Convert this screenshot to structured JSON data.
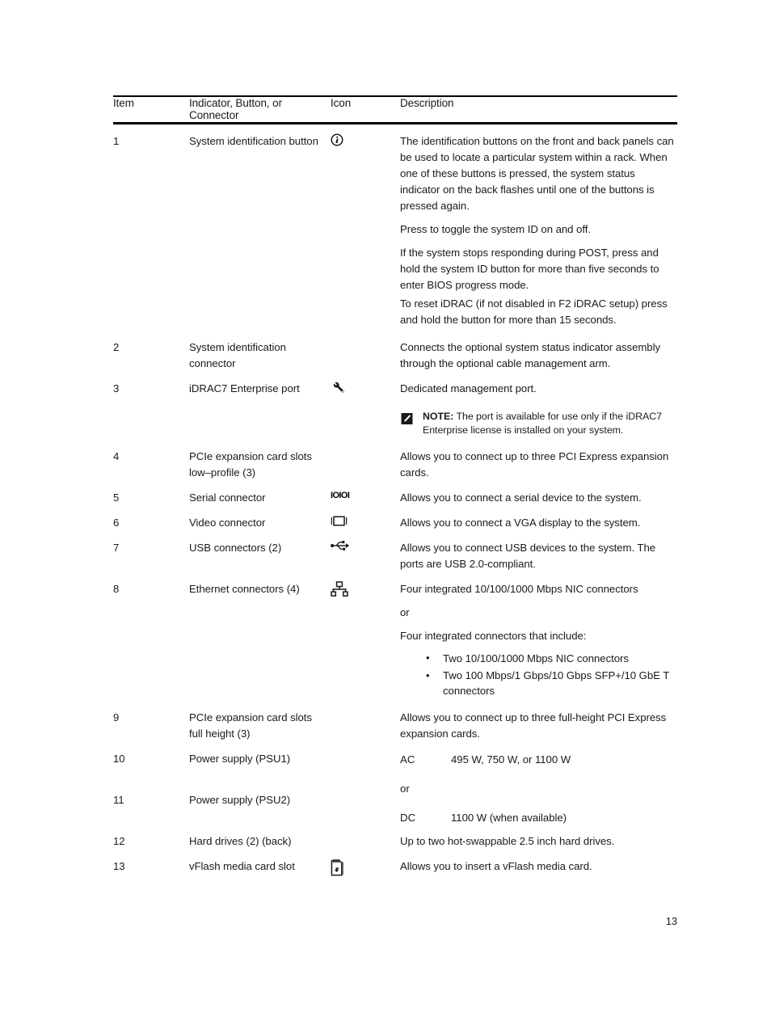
{
  "page": {
    "number": "13"
  },
  "table": {
    "headers": {
      "item": "Item",
      "connector_line1": "Indicator, Button, or",
      "connector_line2": "Connector",
      "icon": "Icon",
      "description": "Description"
    },
    "rows": [
      {
        "item": "1",
        "name_line1": "System identification button",
        "name_line2": "",
        "icon": "info-circle-icon",
        "desc_paragraphs": [
          "The identification buttons on the front and back panels can be used to locate a particular system within a rack. When one of these buttons is pressed, the system status indicator on the back flashes until one of the buttons is pressed again.",
          "Press to toggle the system ID on and off.",
          "If the system stops responding during POST, press and hold the system ID button for more than five seconds to enter BIOS progress mode.",
          "To reset iDRAC (if not disabled in F2 iDRAC setup) press and hold the button for more than 15 seconds."
        ]
      },
      {
        "item": "2",
        "name_line1": "System identification",
        "name_line2": "connector",
        "icon": "",
        "desc_paragraphs": [
          "Connects the optional system status indicator assembly through the optional cable management arm."
        ]
      },
      {
        "item": "3",
        "name_line1": "iDRAC7 Enterprise port",
        "name_line2": "",
        "icon": "wrench-icon",
        "desc_paragraphs": [
          "Dedicated management port."
        ],
        "note": {
          "label": "NOTE:",
          "text": " The port is available for use only if the iDRAC7 Enterprise license is installed on your system."
        }
      },
      {
        "item": "4",
        "name_line1": "PCIe expansion card slots",
        "name_line2": "low–profile (3)",
        "icon": "",
        "desc_paragraphs": [
          "Allows you to connect up to three PCI Express expansion cards."
        ]
      },
      {
        "item": "5",
        "name_line1": "Serial connector",
        "name_line2": "",
        "icon": "serial-connector-icon",
        "icon_text": "IOIOI",
        "desc_paragraphs": [
          "Allows you to connect a serial device to the system."
        ]
      },
      {
        "item": "6",
        "name_line1": "Video connector",
        "name_line2": "",
        "icon": "video-connector-icon",
        "desc_paragraphs": [
          "Allows you to connect a VGA display to the system."
        ]
      },
      {
        "item": "7",
        "name_line1": "USB connectors (2)",
        "name_line2": "",
        "icon": "usb-icon",
        "desc_paragraphs": [
          "Allows you to connect USB devices to the system. The ports are USB 2.0-compliant."
        ]
      },
      {
        "item": "8",
        "name_line1": "Ethernet connectors (4)",
        "name_line2": "",
        "icon": "ethernet-icon",
        "desc_paragraphs": [
          "Four integrated 10/100/1000 Mbps NIC connectors",
          "or",
          "Four integrated connectors that include:"
        ],
        "bullets": [
          "Two 10/100/1000 Mbps NIC connectors",
          "Two 100 Mbps/1 Gbps/10 Gbps SFP+/10 GbE T connectors"
        ]
      },
      {
        "item": "9",
        "name_line1": "PCIe expansion card slots",
        "name_line2": "full height (3)",
        "icon": "",
        "desc_paragraphs": [
          "Allows you to connect up to three full-height PCI Express expansion cards."
        ]
      },
      {
        "item": "10",
        "name_line1": "Power supply (PSU1)",
        "name_line2": "",
        "icon": "",
        "desc_paragraphs": []
      },
      {
        "item": "11",
        "name_line1": "Power supply (PSU2)",
        "name_line2": "",
        "icon": "",
        "desc_paragraphs": []
      },
      {
        "item": "12",
        "name_line1": "Hard drives (2) (back)",
        "name_line2": "",
        "icon": "",
        "desc_paragraphs": [
          "Up to two hot-swappable 2.5 inch hard drives."
        ]
      },
      {
        "item": "13",
        "name_line1": "vFlash media card slot",
        "name_line2": "",
        "icon": "vflash-media-card-icon",
        "desc_paragraphs": [
          "Allows you to insert a vFlash media card."
        ]
      }
    ],
    "power_supply": {
      "ac_label": "AC",
      "ac_value": "495 W, 750 W, or 1100 W",
      "or_label": "or",
      "dc_label": "DC",
      "dc_value": "1100 W (when available)"
    }
  }
}
